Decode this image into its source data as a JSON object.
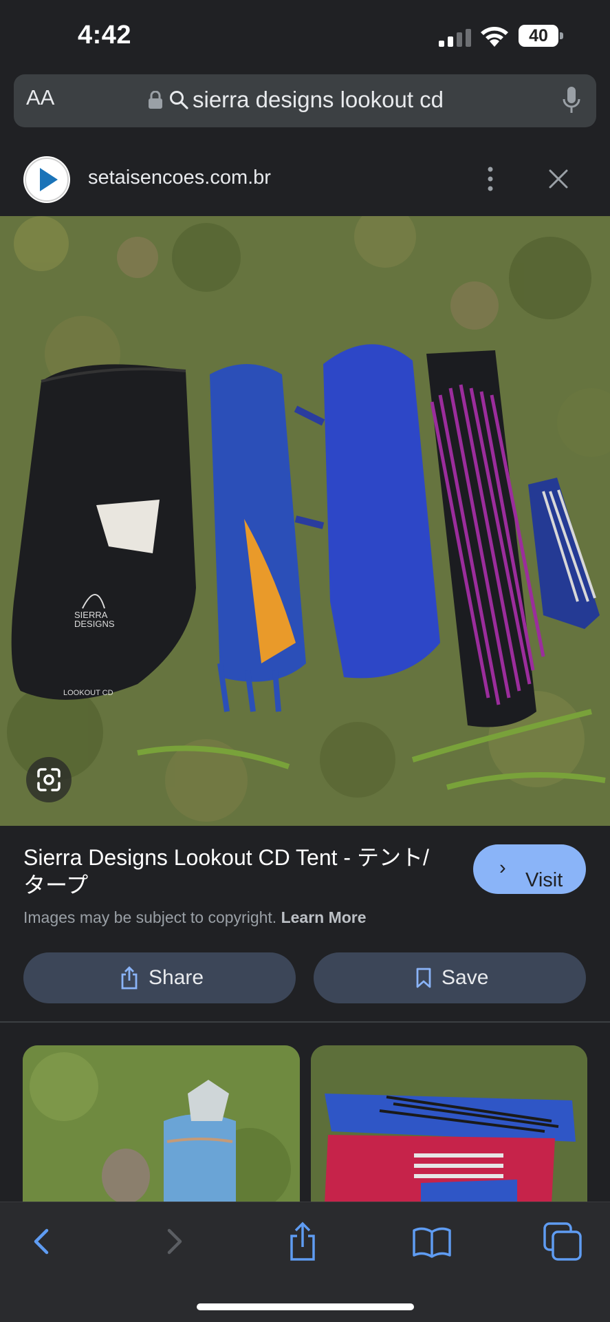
{
  "status_bar": {
    "time": "4:42",
    "battery": "40"
  },
  "address_bar": {
    "aa_label": "AA",
    "url": "sierra designs lookout cd"
  },
  "site": {
    "domain": "setaisencoes.com.br"
  },
  "result": {
    "title": "Sierra Designs Lookout CD Tent - テント/タープ",
    "visit_label": "Visit",
    "copyright_text": "Images may be subject to copyright.",
    "learn_more": "Learn More",
    "share_label": "Share",
    "save_label": "Save"
  },
  "image_text": {
    "brand_line1": "SIERRA",
    "brand_line2": "DESIGNS",
    "model": "LOOKOUT CD"
  },
  "colors": {
    "accent": "#8ab4f8",
    "background": "#202124",
    "pill": "#3c4658"
  }
}
